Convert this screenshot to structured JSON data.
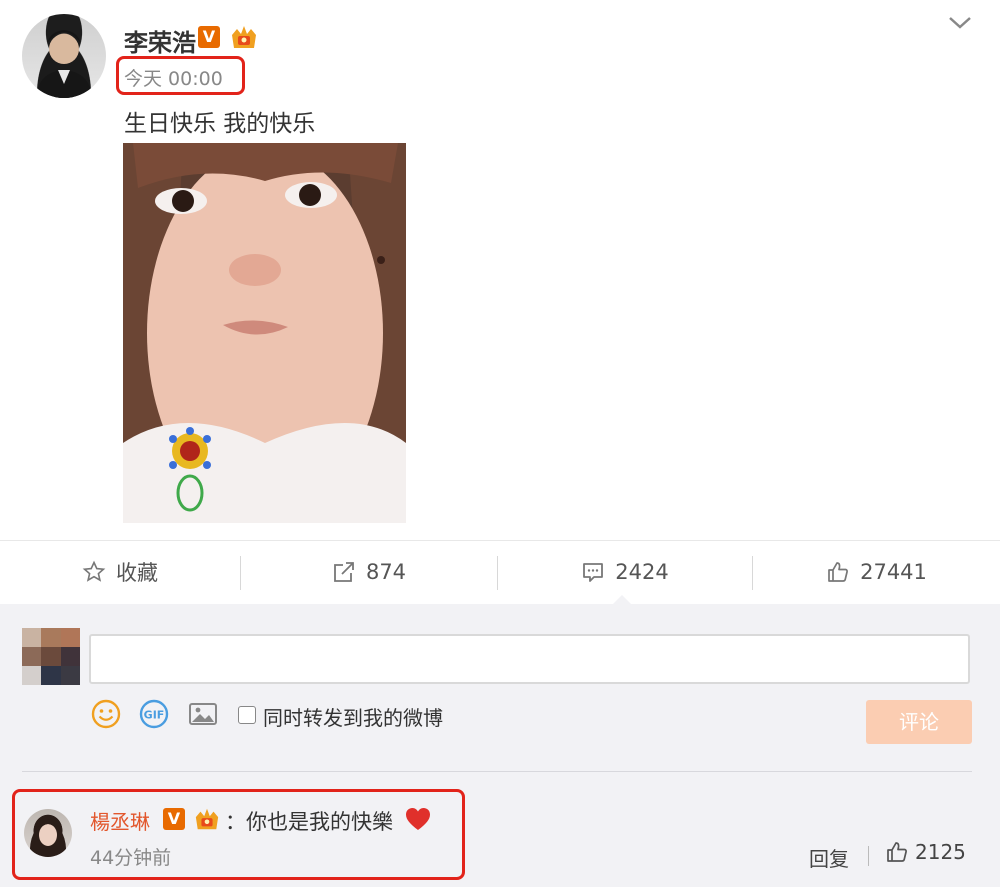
{
  "post": {
    "username": "李荣浩",
    "verified_badge": "V",
    "timestamp": "今天 00:00",
    "text": "生日快乐 我的快乐"
  },
  "actions": {
    "favorite_label": "收藏",
    "repost_count": "874",
    "comment_count": "2424",
    "like_count": "27441"
  },
  "composer": {
    "input_value": "",
    "share_label": "同时转发到我的微博",
    "submit_label": "评论",
    "icons": [
      "emoji-icon",
      "gif-icon",
      "image-icon"
    ]
  },
  "comment": {
    "username": "楊丞琳",
    "verified_badge": "V",
    "separator": "：",
    "text": "你也是我的快樂",
    "time": "44分钟前",
    "reply_label": "回复",
    "like_count": "2125"
  },
  "colors": {
    "highlight_box": "#e2231a",
    "vip_orange": "#e86a00",
    "comment_name": "#e2572d",
    "submit_disabled": "#fbcdb2",
    "comment_bg": "#f2f2f5"
  }
}
